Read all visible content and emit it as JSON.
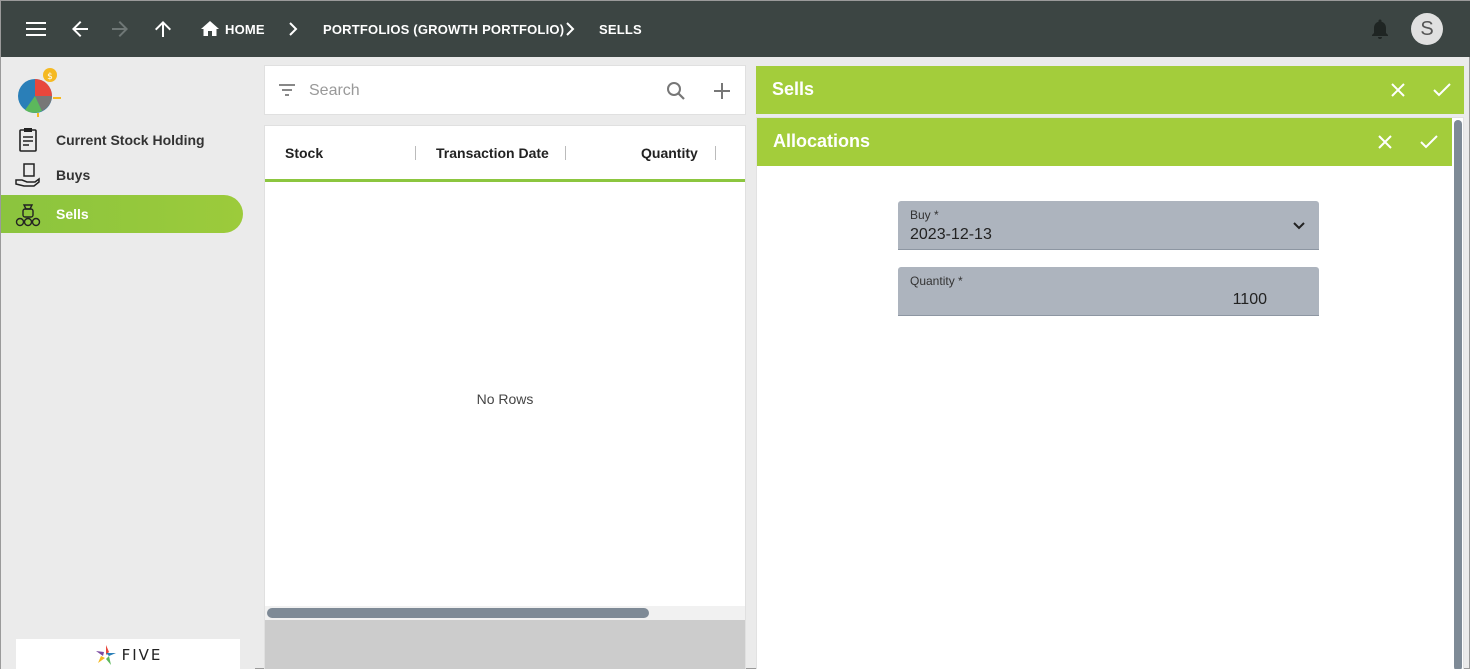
{
  "topbar": {
    "breadcrumbs": [
      {
        "label": "HOME"
      },
      {
        "label": "PORTFOLIOS (GROWTH PORTFOLIO)"
      },
      {
        "label": "SELLS"
      }
    ],
    "avatar_initial": "S"
  },
  "sidebar": {
    "items": [
      {
        "label": "Current Stock Holding",
        "icon": "clipboard-chart-icon"
      },
      {
        "label": "Buys",
        "icon": "hand-money-icon"
      },
      {
        "label": "Sells",
        "icon": "money-bag-icon",
        "active": true
      }
    ],
    "brand": "FIVE"
  },
  "list": {
    "search_placeholder": "Search",
    "columns": [
      "Stock",
      "Transaction Date",
      "Quantity"
    ],
    "empty_message": "No Rows"
  },
  "sells_panel": {
    "title": "Sells"
  },
  "allocations_panel": {
    "title": "Allocations",
    "fields": {
      "buy": {
        "label": "Buy *",
        "value": "2023-12-13"
      },
      "quantity": {
        "label": "Quantity *",
        "value": "1100"
      }
    }
  },
  "colors": {
    "topbar": "#3c4543",
    "accent_green": "#a3cd3b",
    "field_bg": "#adb4be"
  }
}
